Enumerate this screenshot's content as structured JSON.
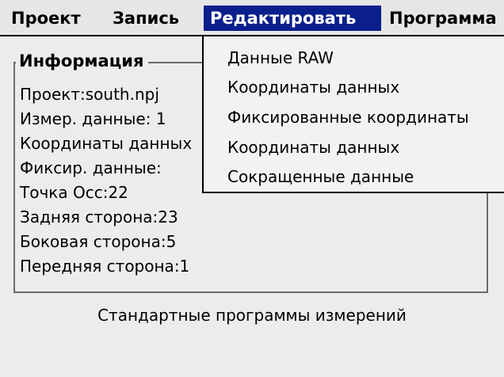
{
  "menubar": {
    "project": "Проект",
    "record": "Запись",
    "edit": "Редактировать",
    "program": "Программа"
  },
  "edit_menu": {
    "items": [
      "Данные RAW",
      "Координаты данных",
      "Фиксированные координаты",
      "Координаты данных",
      "Сокращенные данные"
    ]
  },
  "info": {
    "title": "Информация",
    "project": "Проект:south.npj",
    "measured": "Измер. данные:   1",
    "coords": "Координаты данных",
    "fixed": "Фиксир. данные:",
    "occ_point": "Точка Осс:22",
    "backsight": "Задняя сторона:23",
    "sideshot": "Боковая сторона:5",
    "foresight": "Передняя сторона:1"
  },
  "footer": {
    "text": "Стандартные программы измерений"
  },
  "colors": {
    "menu_highlight": "#0a1f8c",
    "background": "#ececec"
  }
}
